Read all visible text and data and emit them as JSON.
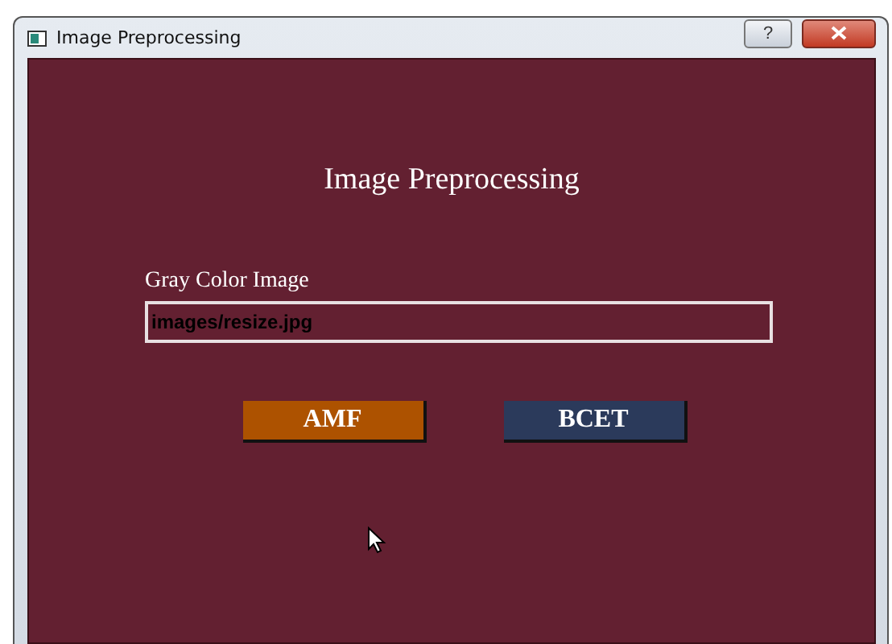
{
  "window": {
    "title": "Image Preprocessing",
    "help_button": "?"
  },
  "heading": "Image Preprocessing",
  "field": {
    "label": "Gray Color Image",
    "value": "images/resize.jpg"
  },
  "buttons": [
    {
      "label": "AMF",
      "color": "#ad5200"
    },
    {
      "label": "BCET",
      "color": "#2b3a5b"
    }
  ]
}
